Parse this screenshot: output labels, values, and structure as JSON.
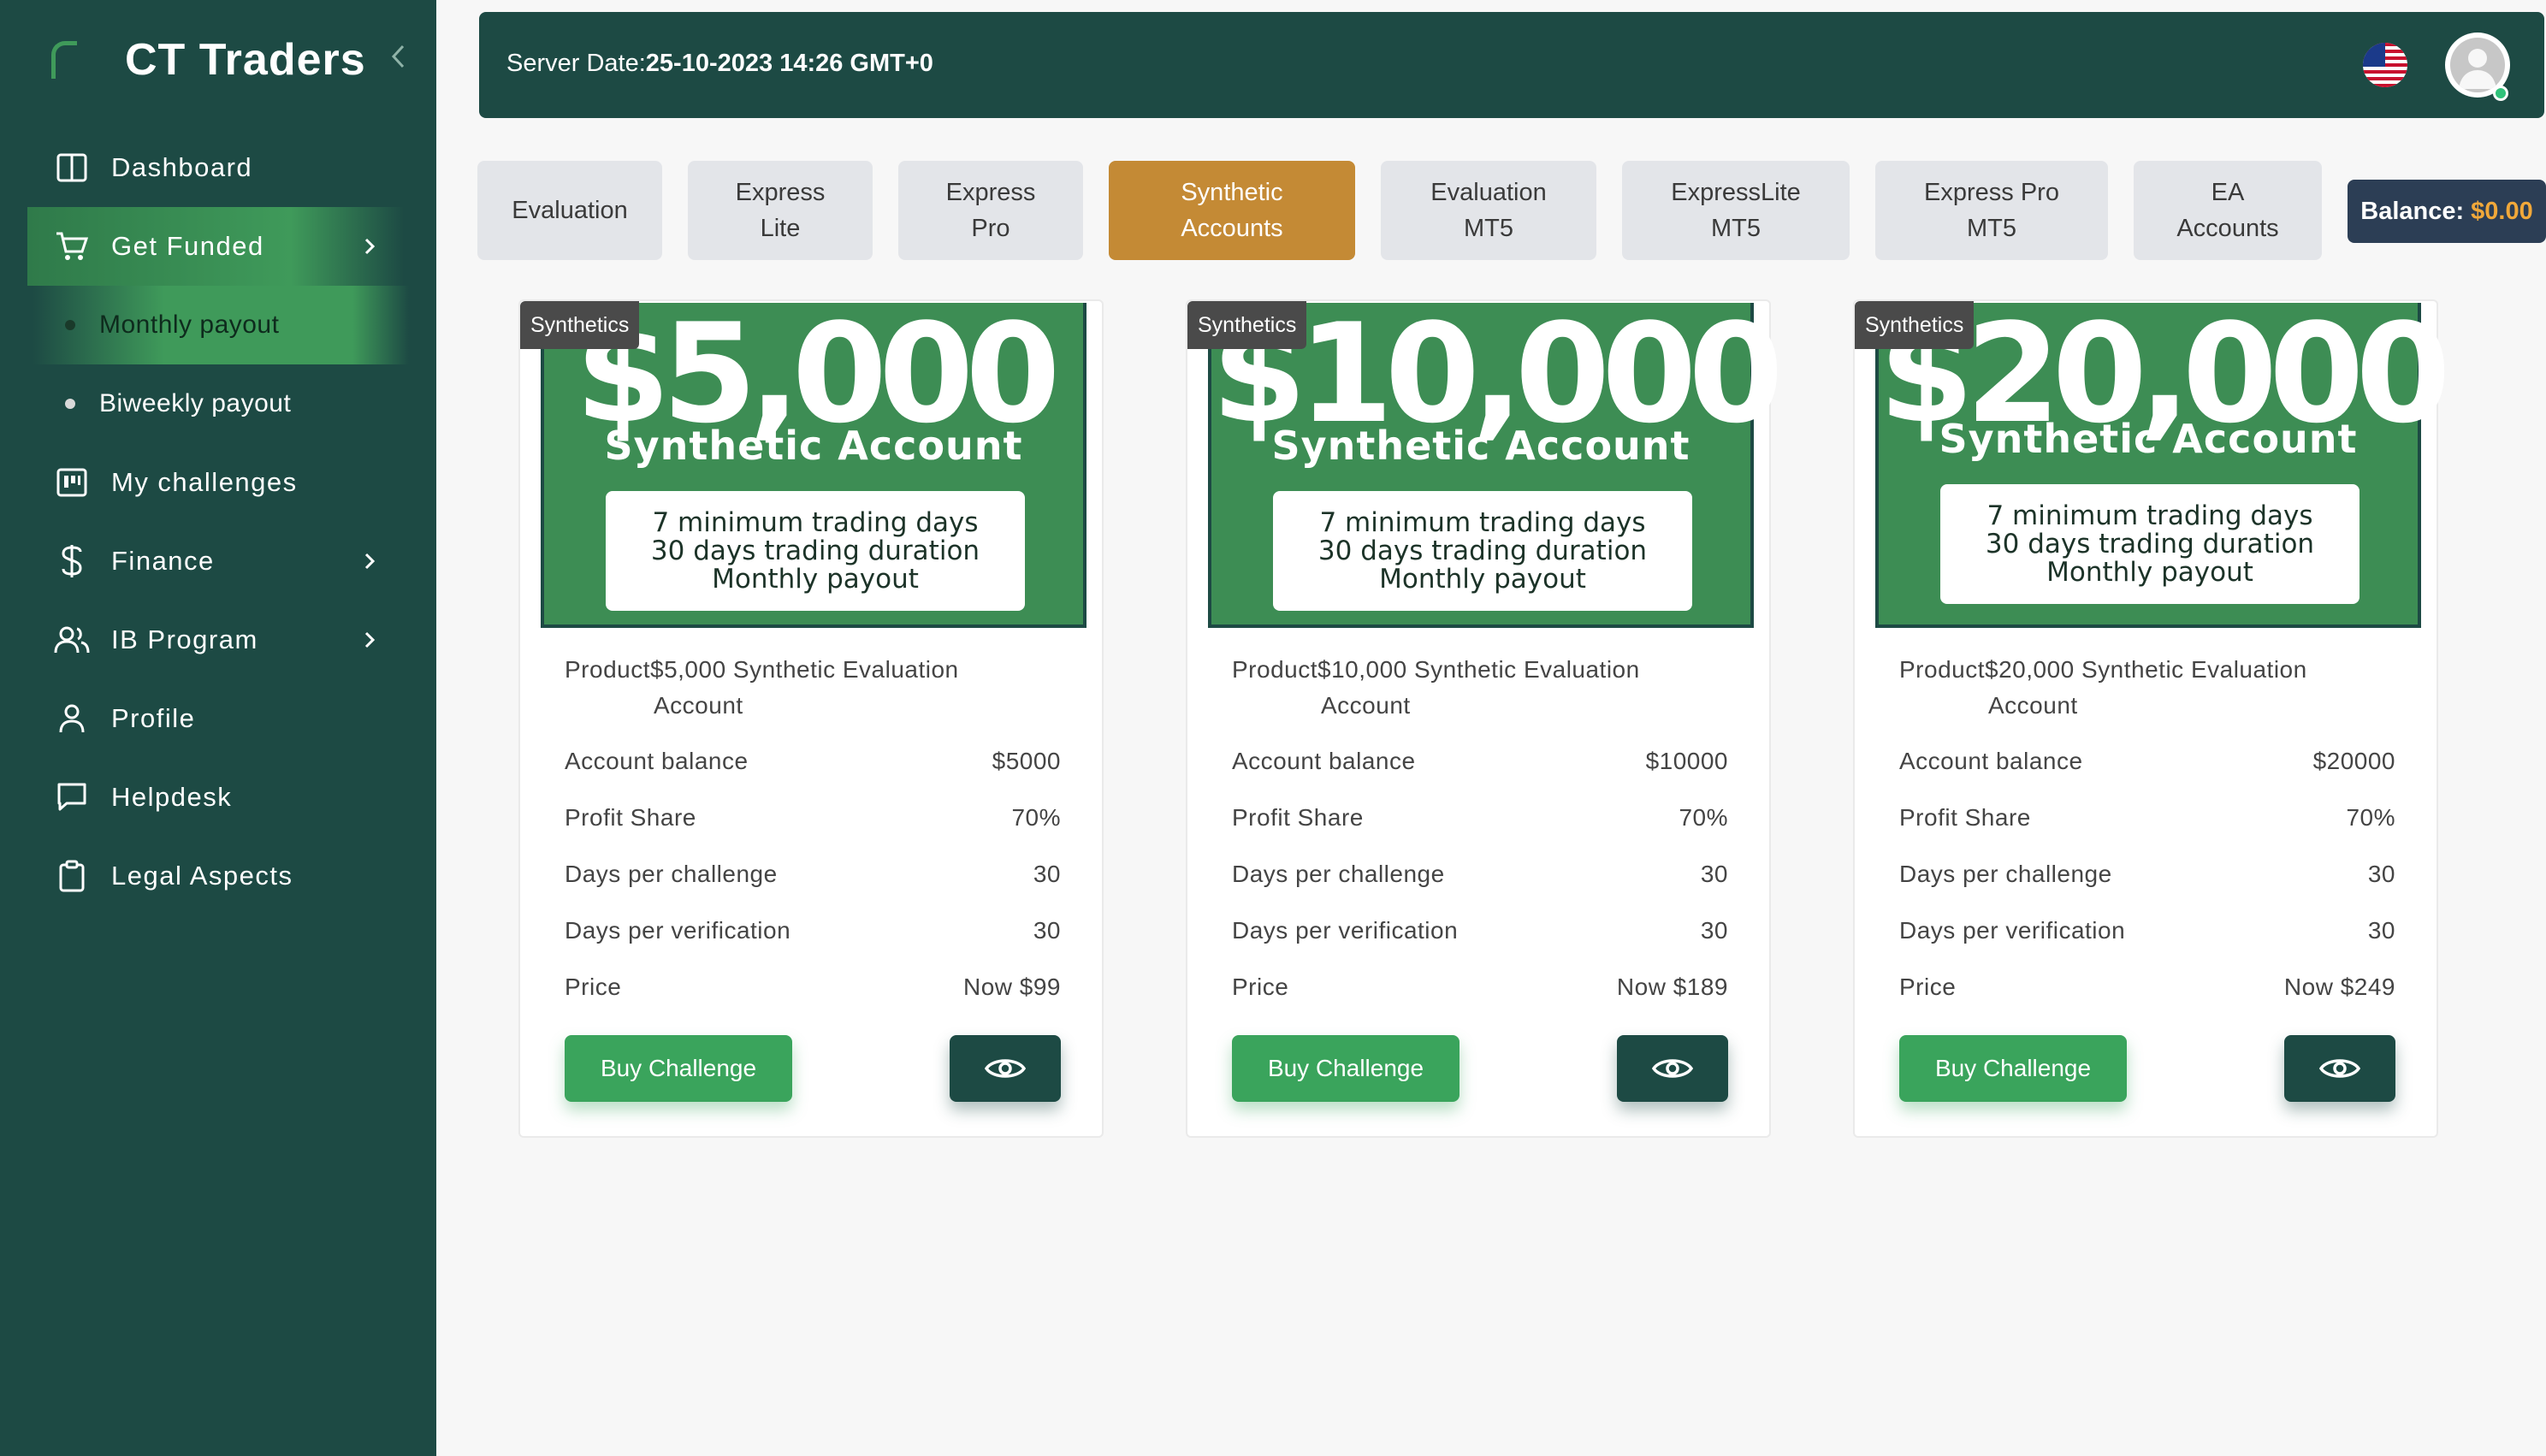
{
  "app": {
    "name": "CT Traders"
  },
  "sidebar": {
    "items": [
      {
        "label": "Dashboard",
        "icon": "book-open-icon"
      },
      {
        "label": "Get Funded",
        "icon": "cart-icon"
      },
      {
        "label": "Monthly payout"
      },
      {
        "label": "Biweekly payout"
      },
      {
        "label": "My challenges",
        "icon": "kanban-icon"
      },
      {
        "label": "Finance",
        "icon": "dollar-icon"
      },
      {
        "label": "IB Program",
        "icon": "users-icon"
      },
      {
        "label": "Profile",
        "icon": "user-icon"
      },
      {
        "label": "Helpdesk",
        "icon": "chat-icon"
      },
      {
        "label": "Legal Aspects",
        "icon": "clipboard-icon"
      }
    ]
  },
  "header": {
    "server_label": "Server Date:",
    "server_value": "25-10-2023 14:26 GMT+0"
  },
  "tabs": [
    {
      "line1": "Evaluation",
      "line2": ""
    },
    {
      "line1": "Express",
      "line2": "Lite"
    },
    {
      "line1": "Express",
      "line2": "Pro"
    },
    {
      "line1": "Synthetic",
      "line2": "Accounts"
    },
    {
      "line1": "Evaluation",
      "line2": "MT5"
    },
    {
      "line1": "ExpressLite",
      "line2": "MT5"
    },
    {
      "line1": "Express Pro",
      "line2": "MT5"
    },
    {
      "line1": "EA",
      "line2": "Accounts"
    }
  ],
  "balance": {
    "label": "Balance:",
    "amount": "$0.00"
  },
  "labels": {
    "account_balance": "Account balance",
    "profit_share": "Profit Share",
    "days_challenge": "Days per challenge",
    "days_verification": "Days per verification",
    "price": "Price",
    "buy": "Buy Challenge"
  },
  "cards": [
    {
      "tag": "Synthetics",
      "amount": "$5,000",
      "subtitle": "Synthetic Account",
      "features": [
        "7 minimum trading days",
        "30 days trading duration",
        "Monthly payout"
      ],
      "title_line1": "Product$5,000 Synthetic Evaluation",
      "title_line2": "Account",
      "balance": "$5000",
      "profit_share": "70%",
      "days_challenge": "30",
      "days_verification": "30",
      "price": "Now $99"
    },
    {
      "tag": "Synthetics",
      "amount": "$10,000",
      "subtitle": "Synthetic Account",
      "features": [
        "7 minimum trading days",
        "30 days trading duration",
        "Monthly payout"
      ],
      "title_line1": "Product$10,000 Synthetic Evaluation",
      "title_line2": "Account",
      "balance": "$10000",
      "profit_share": "70%",
      "days_challenge": "30",
      "days_verification": "30",
      "price": "Now $189"
    },
    {
      "tag": "Synthetics",
      "amount": "$20,000",
      "subtitle": "Synthetic Account",
      "features": [
        "7 minimum trading days",
        "30 days trading duration",
        "Monthly payout"
      ],
      "title_line1": "Product$20,000 Synthetic Evaluation",
      "title_line2": "Account",
      "balance": "$20000",
      "profit_share": "70%",
      "days_challenge": "30",
      "days_verification": "30",
      "price": "Now $249"
    }
  ]
}
